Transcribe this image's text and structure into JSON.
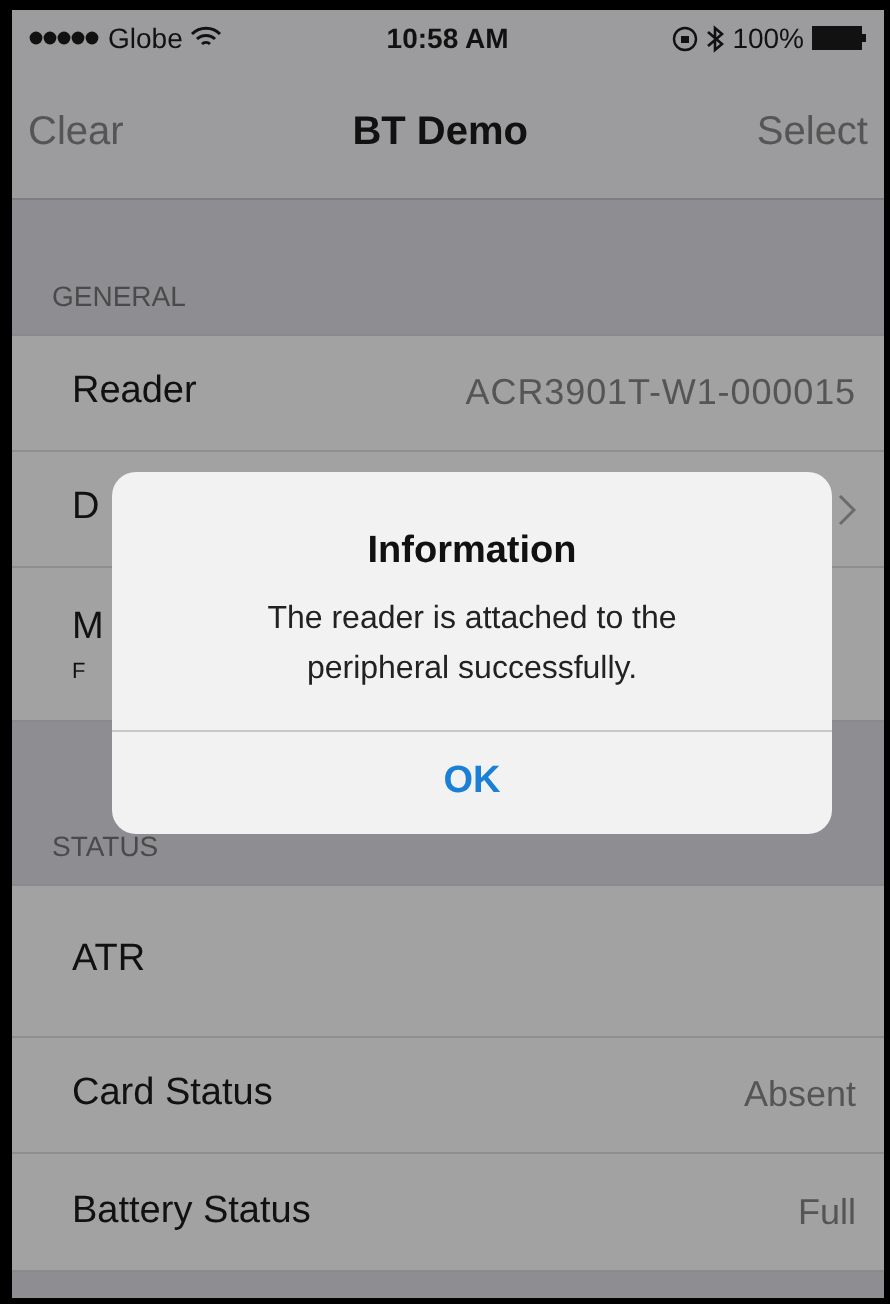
{
  "status_bar": {
    "carrier": "Globe",
    "time": "10:58 AM",
    "battery": "100%"
  },
  "nav": {
    "left": "Clear",
    "title": "BT Demo",
    "right": "Select"
  },
  "sections": [
    {
      "header": "GENERAL",
      "rows": [
        {
          "label": "Reader",
          "value": "ACR3901T-W1-000015",
          "chevron": false
        },
        {
          "label": "D",
          "chevron": true
        },
        {
          "label": "M",
          "subtitle": "F",
          "chevron": false
        }
      ]
    },
    {
      "header": "STATUS",
      "rows": [
        {
          "label": "ATR",
          "chevron": false
        },
        {
          "label": "Card Status",
          "value": "Absent",
          "chevron": false
        },
        {
          "label": "Battery Status",
          "value": "Full",
          "chevron": false
        }
      ]
    }
  ],
  "alert": {
    "title": "Information",
    "message": "The reader is attached to the peripheral successfully.",
    "button": "OK"
  }
}
